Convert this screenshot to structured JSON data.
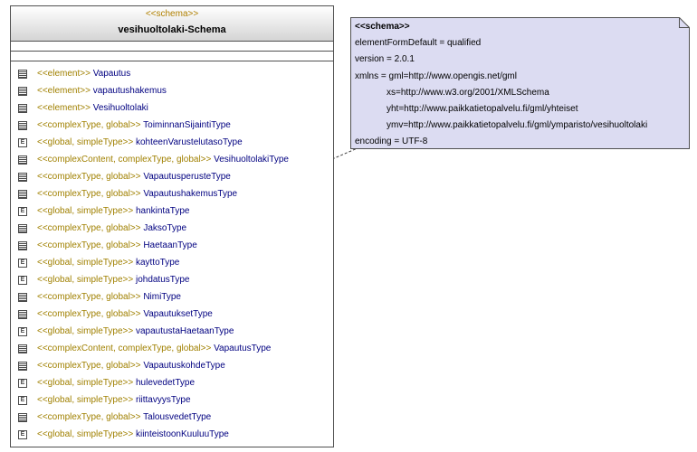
{
  "class_box": {
    "stereotype": "<<schema>>",
    "title": "vesihuoltolaki-Schema",
    "rows": [
      {
        "kind": "complex",
        "stereotype": "<<element>>",
        "name": "Vapautus"
      },
      {
        "kind": "complex",
        "stereotype": "<<element>>",
        "name": "vapautushakemus"
      },
      {
        "kind": "complex",
        "stereotype": "<<element>>",
        "name": "Vesihuoltolaki"
      },
      {
        "kind": "complex",
        "stereotype": "<<complexType, global>>",
        "name": "ToiminnanSijaintiType"
      },
      {
        "kind": "simple",
        "stereotype": "<<global, simpleType>>",
        "name": "kohteenVarustelutasoType"
      },
      {
        "kind": "complex",
        "stereotype": "<<complexContent, complexType, global>>",
        "name": "VesihuoltolakiType"
      },
      {
        "kind": "complex",
        "stereotype": "<<complexType, global>>",
        "name": "VapautusperusteType"
      },
      {
        "kind": "complex",
        "stereotype": "<<complexType, global>>",
        "name": "VapautushakemusType"
      },
      {
        "kind": "simple",
        "stereotype": "<<global, simpleType>>",
        "name": "hankintaType"
      },
      {
        "kind": "complex",
        "stereotype": "<<complexType, global>>",
        "name": "JaksoType"
      },
      {
        "kind": "complex",
        "stereotype": "<<complexType, global>>",
        "name": "HaetaanType"
      },
      {
        "kind": "simple",
        "stereotype": "<<global, simpleType>>",
        "name": "kayttoType"
      },
      {
        "kind": "simple",
        "stereotype": "<<global, simpleType>>",
        "name": "johdatusType"
      },
      {
        "kind": "complex",
        "stereotype": "<<complexType, global>>",
        "name": "NimiType"
      },
      {
        "kind": "complex",
        "stereotype": "<<complexType, global>>",
        "name": "VapautuksetType"
      },
      {
        "kind": "simple",
        "stereotype": "<<global, simpleType>>",
        "name": "vapautustaHaetaanType"
      },
      {
        "kind": "complex",
        "stereotype": "<<complexContent, complexType, global>>",
        "name": "VapautusType"
      },
      {
        "kind": "complex",
        "stereotype": "<<complexType, global>>",
        "name": "VapautuskohdeType"
      },
      {
        "kind": "simple",
        "stereotype": "<<global, simpleType>>",
        "name": "hulevedetType"
      },
      {
        "kind": "simple",
        "stereotype": "<<global, simpleType>>",
        "name": "riittavyysType"
      },
      {
        "kind": "complex",
        "stereotype": "<<complexType, global>>",
        "name": "TalousvedetType"
      },
      {
        "kind": "simple",
        "stereotype": "<<global, simpleType>>",
        "name": "kiinteistoonKuuluuType"
      }
    ]
  },
  "note": {
    "header": "<<schema>>",
    "lines": [
      {
        "indent": false,
        "text": "elementFormDefault = qualified"
      },
      {
        "indent": false,
        "text": "version = 2.0.1"
      },
      {
        "indent": false,
        "text": "xmlns = gml=http://www.opengis.net/gml"
      },
      {
        "indent": true,
        "text": "xs=http://www.w3.org/2001/XMLSchema"
      },
      {
        "indent": true,
        "text": "yht=http://www.paikkatietopalvelu.fi/gml/yhteiset"
      },
      {
        "indent": true,
        "text": "ymv=http://www.paikkatietopalvelu.fi/gml/ymparisto/vesihuoltolaki"
      },
      {
        "indent": false,
        "text": "encoding = UTF-8"
      }
    ]
  },
  "colors": {
    "stereotype": "#a08000",
    "name": "#000080",
    "note_fill": "#dcdcf2",
    "border": "#505050"
  }
}
